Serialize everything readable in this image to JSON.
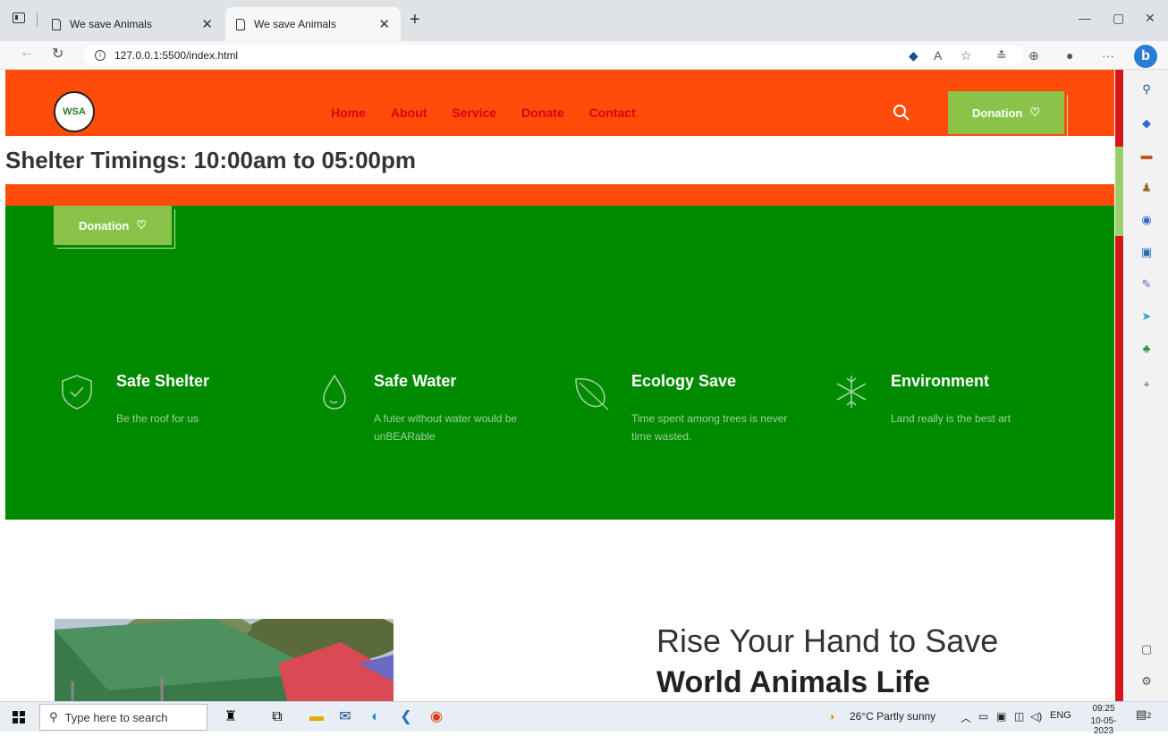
{
  "browser": {
    "tabs": [
      {
        "title": "We save Animals",
        "active": false
      },
      {
        "title": "We save Animals",
        "active": true
      }
    ],
    "new_tab": "+",
    "url": "127.0.0.1:5500/index.html",
    "window_controls": [
      "—",
      "▢",
      "✕"
    ]
  },
  "site": {
    "logo_text": "WSA",
    "nav": [
      "Home",
      "About",
      "Service",
      "Donate",
      "Contact"
    ],
    "donation_label": "Donation",
    "timing_text": "Shelter Timings: 10:00am to 05:00pm",
    "features": [
      {
        "icon": "shield-check-icon",
        "title": "Safe Shelter",
        "text": "Be the roof for us"
      },
      {
        "icon": "water-drop-icon",
        "title": "Safe Water",
        "text": "A futer without water would be unBEARable"
      },
      {
        "icon": "leaf-icon",
        "title": "Ecology Save",
        "text": "Time spent among trees is never time wasted."
      },
      {
        "icon": "snowflake-icon",
        "title": "Environment",
        "text": "Land really is the best art"
      }
    ],
    "headline_line1": "Rise Your Hand to Save",
    "headline_line2": "World Animals Life"
  },
  "colors": {
    "header": "#ff4c0a",
    "nav_text": "#e0000f",
    "green_section": "#008a00",
    "button": "#8bc34a"
  },
  "taskbar": {
    "search_placeholder": "Type here to search",
    "weather": "26°C  Partly sunny",
    "lang": "ENG",
    "time": "09:25",
    "date": "10-05-2023",
    "notifications": "2"
  }
}
